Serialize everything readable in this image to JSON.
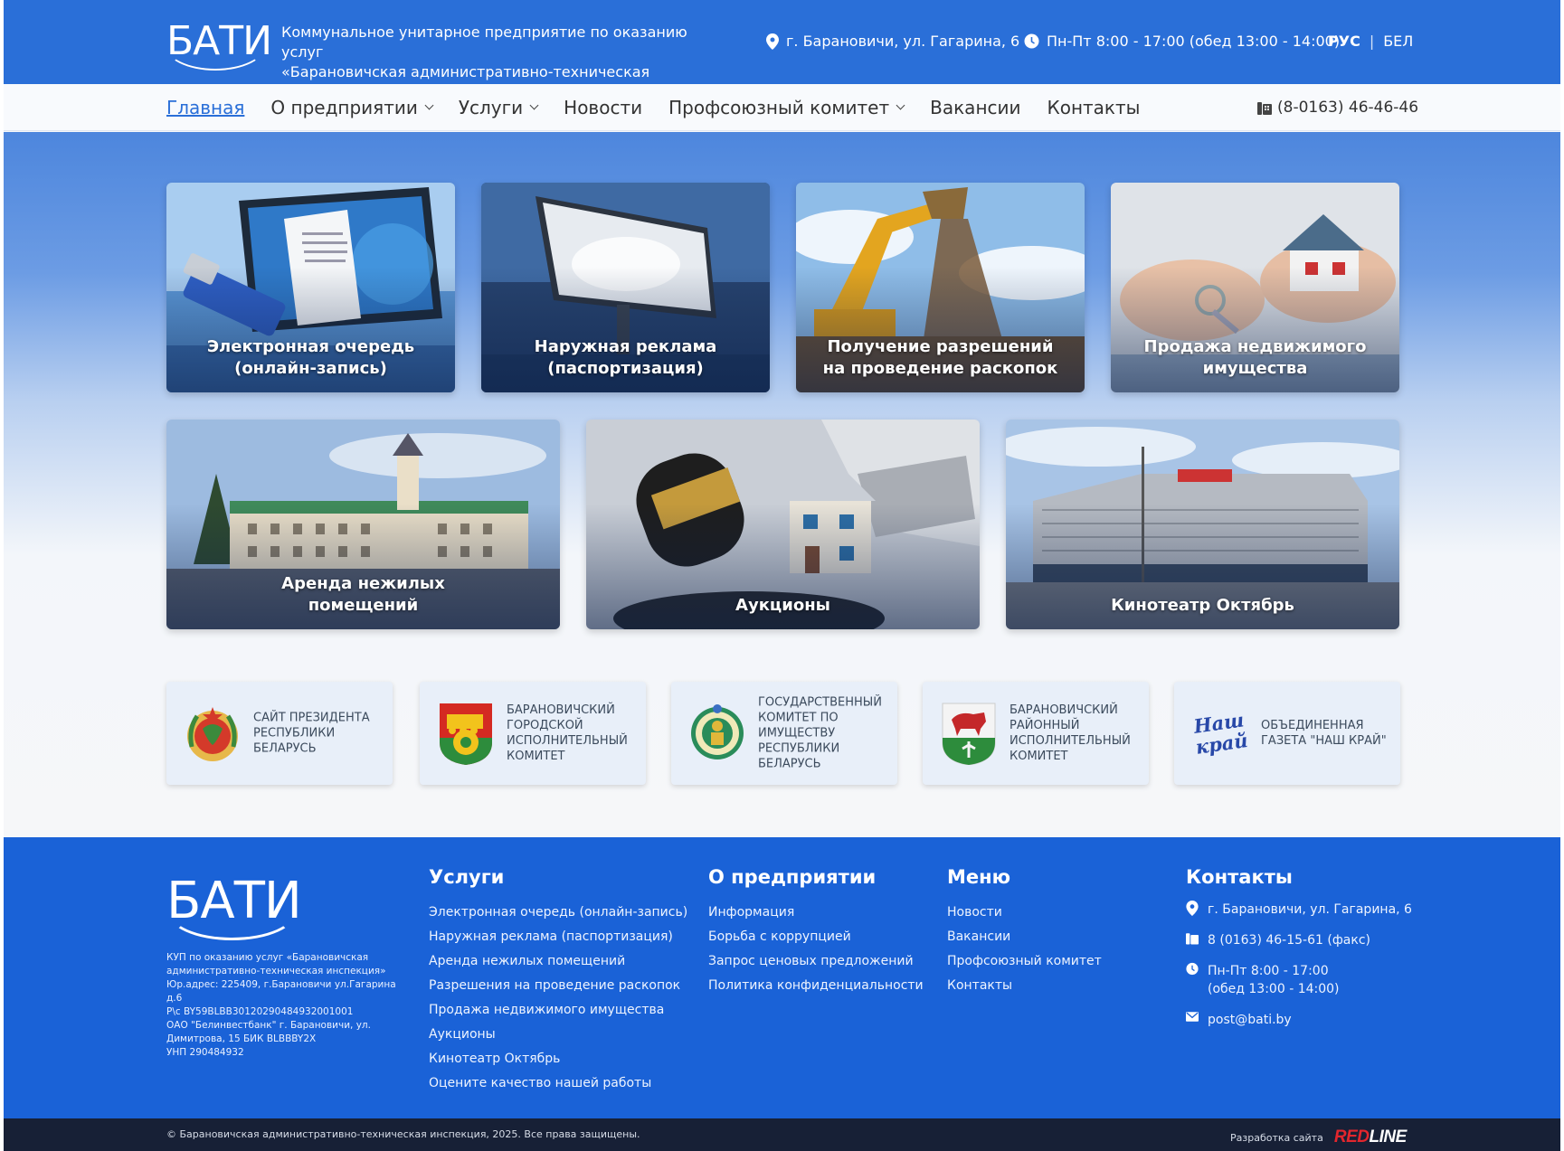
{
  "header": {
    "logo_text": "БАТИ",
    "org_line1": "Коммунальное унитарное предприятие по оказанию услуг",
    "org_line2": "«Барановичская административно-техническая инспекция»",
    "address": "г. Барановичи, ул. Гагарина, 6",
    "hours": "Пн-Пт 8:00 - 17:00 (обед 13:00 - 14:00)",
    "lang_active": "РУС",
    "lang_other": "БЕЛ"
  },
  "nav": {
    "items": [
      {
        "label": "Главная"
      },
      {
        "label": "О предприятии"
      },
      {
        "label": "Услуги"
      },
      {
        "label": "Новости"
      },
      {
        "label": "Профсоюзный комитет"
      },
      {
        "label": "Вакансии"
      },
      {
        "label": "Контакты"
      }
    ],
    "phone": "(8-0163) 46-46-46"
  },
  "services": [
    {
      "line1": "Электронная очередь",
      "line2": "(онлайн-запись)"
    },
    {
      "line1": "Наружная реклама",
      "line2": "(паспортизация)"
    },
    {
      "line1": "Получение разрешений",
      "line2": "на проведение раскопок"
    },
    {
      "line1": "Продажа недвижимого",
      "line2": "имущества"
    },
    {
      "line1": "Аренда нежилых",
      "line2": "помещений"
    },
    {
      "line1": "",
      "line2": "Аукционы"
    },
    {
      "line1": "",
      "line2": "Кинотеатр Октябрь"
    }
  ],
  "partners": [
    {
      "text": "Сайт Президента Республики Беларусь"
    },
    {
      "text": "Барановичский городской исполнительный комитет"
    },
    {
      "text": "Государственный комитет по имуществу Республики Беларусь"
    },
    {
      "text": "Барановичский районный исполнительный комитет"
    },
    {
      "text": "Объединенная газета \"Наш край\"",
      "logo_text": "Наш край"
    }
  ],
  "footer": {
    "logo_text": "БАТИ",
    "requisites": [
      "КУП по оказанию услуг «Барановичская",
      "административно-техническая инспекция»",
      "Юр.адрес: 225409, г.Барановичи ул.Гагарина д.6",
      "Р\\с BY59BLBB30120290484932001001",
      "ОАО \"Белинвестбанк\" г. Барановичи, ул.",
      "Димитрова, 15 БИК BLBBBY2X",
      "УНП 290484932"
    ],
    "services_title": "Услуги",
    "services_links": [
      "Электронная очередь (онлайн-запись)",
      "Наружная реклама (паспортизация)",
      "Аренда нежилых помещений",
      "Разрешения на проведение раскопок",
      "Продажа недвижимого имущества",
      "Аукционы",
      "Кинотеатр Октябрь",
      "Оцените качество нашей работы"
    ],
    "about_title": "О предприятии",
    "about_links": [
      "Информация",
      "Борьба с коррупцией",
      "Запрос ценовых предложений",
      "Политика конфиденциальности"
    ],
    "menu_title": "Меню",
    "menu_links": [
      "Новости",
      "Вакансии",
      "Профсоюзный комитет",
      "Контакты"
    ],
    "contacts_title": "Контакты",
    "address": "г. Барановичи, ул. Гагарина, 6",
    "phone": "8 (0163) 46-15-61 (факс)",
    "hours_line1": "Пн-Пт 8:00 - 17:00",
    "hours_line2": "(обед 13:00 - 14:00)",
    "email": "post@bati.by"
  },
  "bottom": {
    "copyright": "© Барановичская административно-техническая инспекция, 2025. Все права защищены.",
    "developer_label": "Разработка сайта",
    "developer_red": "RED",
    "developer_white": "LINE"
  },
  "colors": {
    "header_blue": "#2a6fd8",
    "footer_blue": "#1a62d7",
    "bottom_bar": "#172036",
    "brand_red": "#e3262d"
  }
}
